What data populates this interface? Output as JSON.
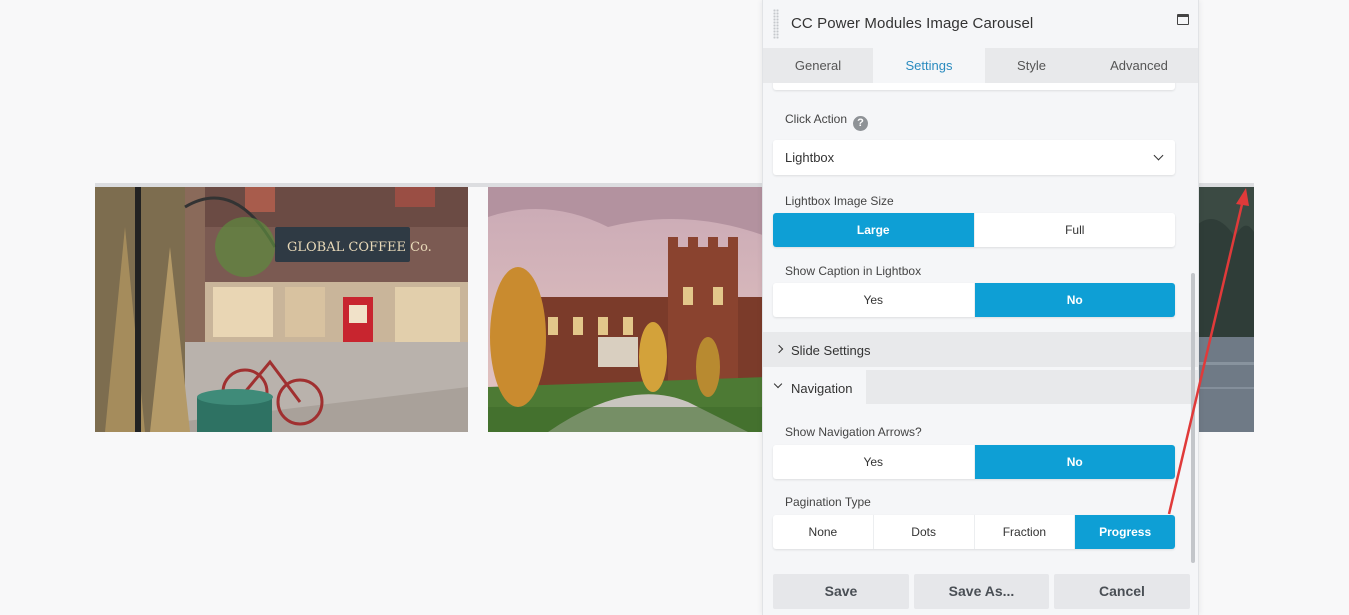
{
  "panel": {
    "title": "CC Power Modules Image Carousel",
    "tabs": [
      {
        "label": "General",
        "active": false
      },
      {
        "label": "Settings",
        "active": true
      },
      {
        "label": "Style",
        "active": false
      },
      {
        "label": "Advanced",
        "active": false
      }
    ]
  },
  "settings": {
    "click_action": {
      "label": "Click Action",
      "help": "?",
      "value": "Lightbox"
    },
    "lightbox_image_size": {
      "label": "Lightbox Image Size",
      "options": [
        "Large",
        "Full"
      ],
      "selected": "Large"
    },
    "show_caption": {
      "label": "Show Caption in Lightbox",
      "options": [
        "Yes",
        "No"
      ],
      "selected": "No"
    },
    "slide_settings": {
      "label": "Slide Settings",
      "expanded": false
    },
    "navigation": {
      "label": "Navigation",
      "expanded": true,
      "show_arrows": {
        "label": "Show Navigation Arrows?",
        "options": [
          "Yes",
          "No"
        ],
        "selected": "No"
      },
      "pagination_type": {
        "label": "Pagination Type",
        "options": [
          "None",
          "Dots",
          "Fraction",
          "Progress"
        ],
        "selected": "Progress"
      }
    }
  },
  "footer": {
    "save": "Save",
    "save_as": "Save As...",
    "cancel": "Cancel"
  },
  "colors": {
    "accent": "#0e9fd5",
    "active_tab_text": "#2a8bbf",
    "annotation_arrow": "#e03a3a"
  }
}
